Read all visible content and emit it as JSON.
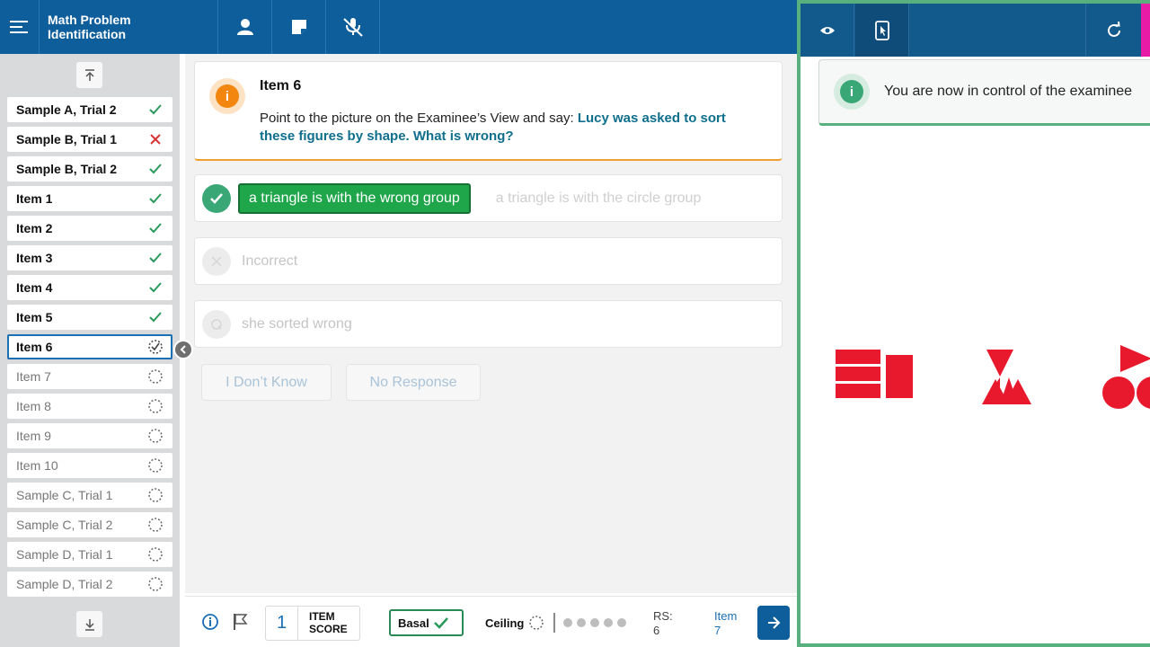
{
  "app": {
    "title": "Math Problem Identification",
    "toolbar_icons": [
      "menu-icon",
      "person-icon",
      "note-icon",
      "mic-off-icon"
    ]
  },
  "sidebar": {
    "items": [
      {
        "label": "Sample A, Trial 2",
        "status": "correct"
      },
      {
        "label": "Sample B, Trial 1",
        "status": "incorrect"
      },
      {
        "label": "Sample B, Trial 2",
        "status": "correct"
      },
      {
        "label": "Item 1",
        "status": "correct"
      },
      {
        "label": "Item 2",
        "status": "correct"
      },
      {
        "label": "Item 3",
        "status": "correct"
      },
      {
        "label": "Item 4",
        "status": "correct"
      },
      {
        "label": "Item 5",
        "status": "correct"
      },
      {
        "label": "Item 6",
        "status": "in-progress"
      },
      {
        "label": "Item 7",
        "status": "pending"
      },
      {
        "label": "Item 8",
        "status": "pending"
      },
      {
        "label": "Item 9",
        "status": "pending"
      },
      {
        "label": "Item 10",
        "status": "pending"
      },
      {
        "label": "Sample C, Trial 1",
        "status": "pending"
      },
      {
        "label": "Sample C, Trial 2",
        "status": "pending"
      },
      {
        "label": "Sample D, Trial 1",
        "status": "pending"
      },
      {
        "label": "Sample D, Trial 2",
        "status": "pending"
      }
    ]
  },
  "prompt": {
    "title": "Item 6",
    "instruction": "Point to the picture on the Examinee’s View and say: ",
    "emphasis": "Lucy was asked to sort these figures by shape. What is wrong?"
  },
  "responses": {
    "correct_selected": "a triangle is with the wrong group",
    "correct_alt": "a triangle is with the circle group",
    "incorrect": "Incorrect",
    "query": "she sorted wrong"
  },
  "actions": {
    "dont_know": "I Don’t Know",
    "no_response": "No Response"
  },
  "footer": {
    "item_score_value": "1",
    "item_score_label_1": "ITEM",
    "item_score_label_2": "SCORE",
    "basal_label": "Basal",
    "ceiling_label": "Ceiling",
    "rs_label": "RS:",
    "rs_value": "6",
    "next_label": "Item",
    "next_value": "7"
  },
  "examinee": {
    "notice": "You are now in control of the examinee"
  },
  "colors": {
    "primary": "#0f5e9c",
    "success": "#1fa54a",
    "warning": "#f2860f",
    "stimulus_red": "#e8192c",
    "panel_border": "#58b07f",
    "pink_tab": "#e81ba7"
  }
}
